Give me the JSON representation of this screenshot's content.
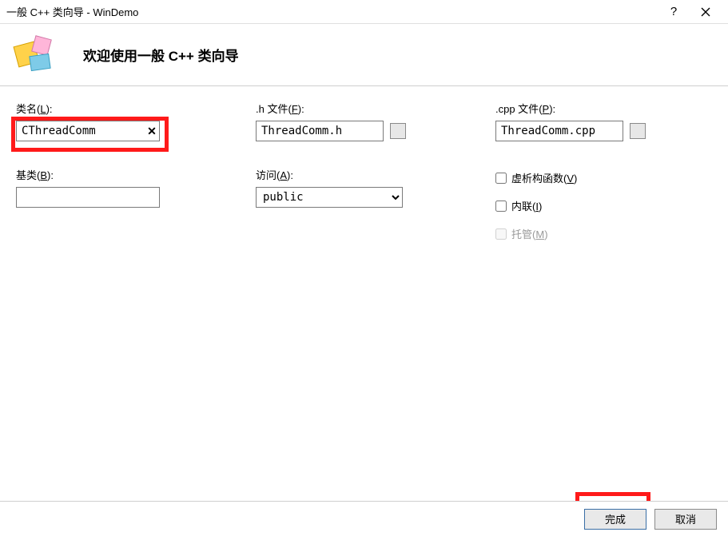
{
  "titlebar": {
    "title": "一般 C++ 类向导 - WinDemo"
  },
  "banner": {
    "title": "欢迎使用一般 C++ 类向导"
  },
  "labels": {
    "className": "类名",
    "classNameKey": "L",
    "hFile": ".h 文件",
    "hFileKey": "F",
    "cppFile": ".cpp 文件",
    "cppFileKey": "P",
    "baseClass": "基类",
    "baseClassKey": "B",
    "access": "访问",
    "accessKey": "A"
  },
  "values": {
    "className": "CThreadComm",
    "hFile": "ThreadComm.h",
    "cppFile": "ThreadComm.cpp",
    "baseClass": "",
    "access": "public"
  },
  "checks": {
    "virtualDtor": "虚析构函数",
    "virtualDtorKey": "V",
    "inline": "内联",
    "inlineKey": "I",
    "managed": "托管",
    "managedKey": "M"
  },
  "buttons": {
    "finish": "完成",
    "cancel": "取消"
  }
}
